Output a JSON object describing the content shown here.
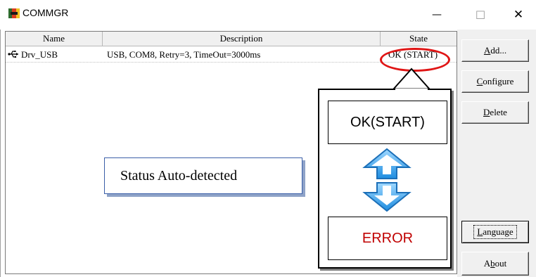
{
  "window": {
    "title": "COMMGR",
    "minimize_glyph": "—",
    "maximize_glyph": "☐",
    "close_glyph": "✕"
  },
  "list": {
    "columns": [
      "Name",
      "Description",
      "State"
    ],
    "rows": [
      {
        "icon": "usb-icon",
        "name": "Drv_USB",
        "description": "USB, COM8, Retry=3, TimeOut=3000ms",
        "state": "OK (START)"
      }
    ]
  },
  "buttons": {
    "add": {
      "underline": "A",
      "rest": "dd..."
    },
    "configure": {
      "underline": "C",
      "rest": "onfigure"
    },
    "delete": {
      "underline": "D",
      "rest": "elete"
    },
    "language": {
      "underline": "L",
      "rest": "anguage"
    },
    "about": {
      "pre": "A",
      "underline": "b",
      "rest": "out"
    }
  },
  "annotation": {
    "status_label": "Status Auto-detected",
    "ok_state": "OK(START)",
    "error_state": "ERROR",
    "highlight_color": "#e01515",
    "arrow_color": "#3da9f5"
  }
}
